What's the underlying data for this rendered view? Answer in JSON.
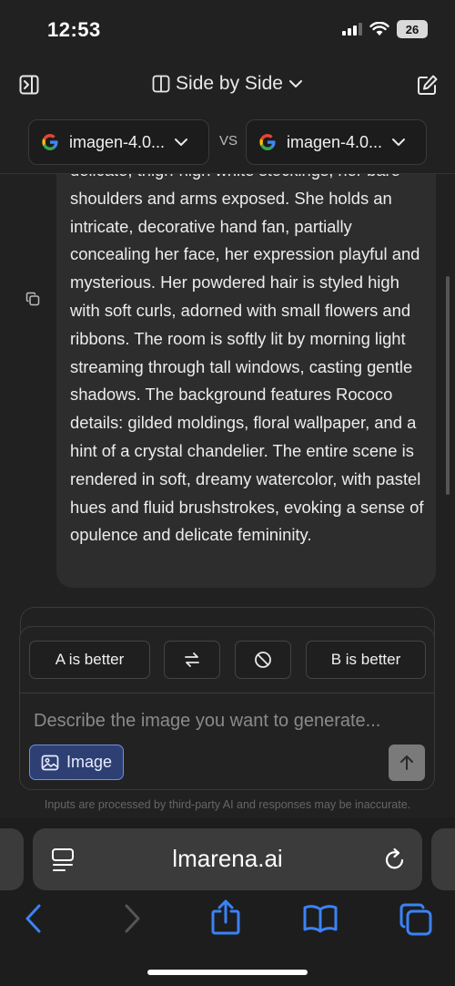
{
  "status_bar": {
    "time": "12:53",
    "battery": "26"
  },
  "header": {
    "title": "Side by Side"
  },
  "models": {
    "left": "imagen-4.0...",
    "vs": "VS",
    "right": "imagen-4.0..."
  },
  "prompt": {
    "text": "delicate, thigh-high white stockings, her bare shoulders and arms exposed. She holds an intricate, decorative hand fan, partially concealing her face, her expression playful and mysterious. Her powdered hair is styled high with soft curls, adorned with small flowers and ribbons. The room is softly lit by morning light streaming through tall windows, casting gentle shadows. The background features Rococo details: gilded moldings, floral wallpaper, and a hint of a crystal chandelier. The entire scene is rendered in soft, dreamy watercolor, with pastel hues and fluid brushstrokes, evoking a sense of opulence and delicate femininity."
  },
  "vote": {
    "a_better": "A is better",
    "b_better": "B is better"
  },
  "input": {
    "placeholder": "Describe the image you want to generate...",
    "image_button": "Image",
    "disclaimer": "Inputs are processed by third-party AI and responses may be inaccurate."
  },
  "browser": {
    "url": "lmarena.ai"
  },
  "colors": {
    "background": "#212121",
    "bubble": "#2d2d2d",
    "accent": "#6f8fe6",
    "safari_blue": "#3b82f6"
  }
}
